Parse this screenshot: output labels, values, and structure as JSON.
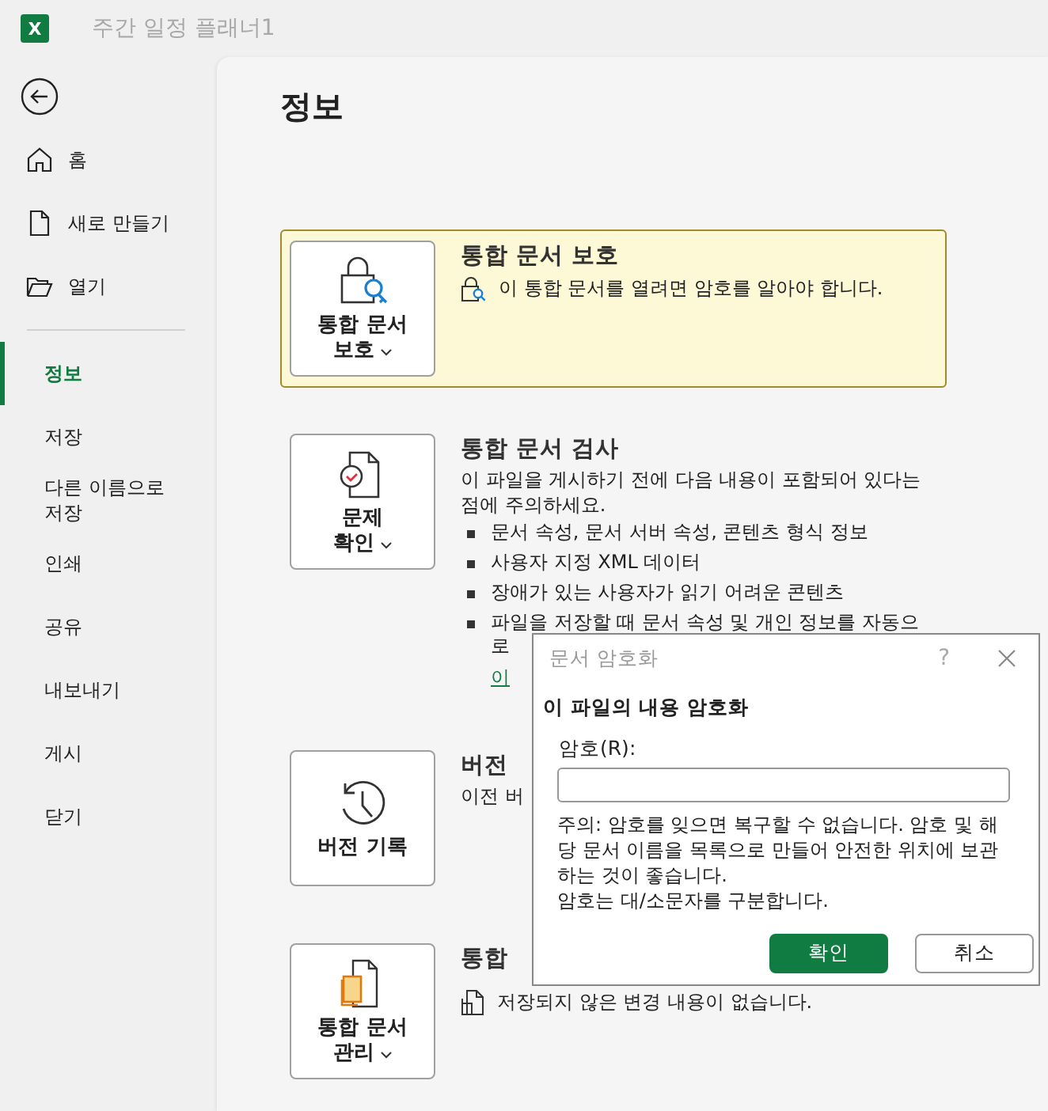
{
  "title_bar": {
    "app_icon_letter": "X",
    "title": "주간 일정 플래너1"
  },
  "sidebar": {
    "top_items": [
      {
        "label": "홈",
        "kind": "home",
        "selected": false
      },
      {
        "label": "새로 만들기",
        "kind": "new",
        "selected": false
      },
      {
        "label": "열기",
        "kind": "open",
        "selected": false
      }
    ],
    "items": [
      {
        "label": "정보",
        "selected": true
      },
      {
        "label": "저장",
        "selected": false
      },
      {
        "label": "다른 이름으로 저장",
        "selected": false
      },
      {
        "label": "인쇄",
        "selected": false
      },
      {
        "label": "공유",
        "selected": false
      },
      {
        "label": "내보내기",
        "selected": false
      },
      {
        "label": "게시",
        "selected": false
      },
      {
        "label": "닫기",
        "selected": false
      }
    ]
  },
  "page_title": "정보",
  "sections": [
    {
      "kind": "protect",
      "highlighted": true,
      "button_lines": [
        "통합 문서",
        "보호"
      ],
      "dropdown": true,
      "title": "통합 문서 보호",
      "note": "이 통합 문서를 열려면 암호를 알아야 합니다."
    },
    {
      "kind": "inspect",
      "highlighted": false,
      "button_lines": [
        "문제",
        "확인"
      ],
      "dropdown": true,
      "title": "통합 문서 검사",
      "description": "이 파일을 게시하기 전에 다음 내용이 포함되어 있다는 점에 주의하세요.",
      "bullets": [
        [
          "문서 속성, 문서 서버 속성, 콘텐츠 형식 정보"
        ],
        [
          "사용자 지정 XML 데이터"
        ],
        [
          "장애가 있는 사용자가 읽기 어려운 콘텐츠"
        ],
        [
          "파일을 저장할 때 문서 속성 및 개인 정보를 자동으",
          "로"
        ]
      ],
      "link": "이"
    },
    {
      "kind": "history",
      "highlighted": false,
      "button_lines": [
        "버전 기록"
      ],
      "dropdown": false,
      "title": "버전",
      "description": "이전 버"
    },
    {
      "kind": "manage",
      "highlighted": false,
      "button_lines": [
        "통합 문서",
        "관리"
      ],
      "dropdown": true,
      "title": "통합",
      "note": "저장되지 않은 변경 내용이 없습니다."
    }
  ],
  "dialog": {
    "title": "문서 암호화",
    "help": "?",
    "heading": "이 파일의 내용 암호화",
    "field_label": "암호(R):",
    "warning": "주의: 암호를 잊으면 복구할 수 없습니다. 암호 및 해당 문서 이름을 목록으로 만들어 안전한 위치에 보관하는 것이 좋습니다.",
    "case_note": "암호는 대/소문자를 구분합니다.",
    "buttons": [
      {
        "label": "확인",
        "kind": "primary"
      },
      {
        "label": "취소",
        "kind": "secondary"
      }
    ]
  }
}
